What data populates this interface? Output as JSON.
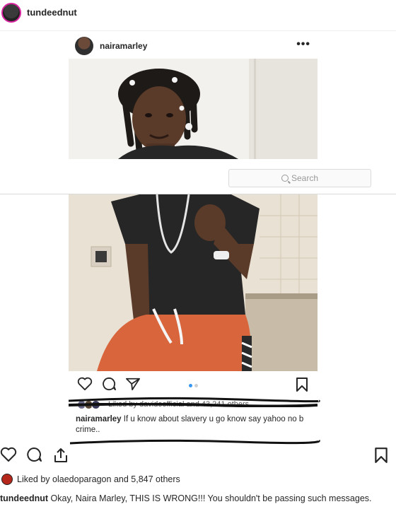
{
  "post": {
    "username": "tundeednut",
    "liked_by_prefix": "Liked by",
    "liked_by_user": "olaedoparagon",
    "liked_by_suffix": "and 5,847 others",
    "caption_username": "tundeednut",
    "caption_text": "Okay, Naira Marley, THIS IS WRONG!!! You shouldn't be passing such messages."
  },
  "embedded_post": {
    "username": "nairamarley",
    "more_icon": "•••",
    "search_placeholder": "Search",
    "likes_text": "Liked by davidoofficial and 43,241 others",
    "caption_username": "nairamarley",
    "caption_text": "If u know about slavery u go know say yahoo no b crime..",
    "carousel": {
      "count": 2,
      "active": 1
    }
  },
  "icons": [
    "heart-icon",
    "comment-icon",
    "share-icon",
    "bookmark-icon",
    "more-icon",
    "search-icon"
  ],
  "colors": {
    "accent": "#3897f0",
    "text": "#262626",
    "story_ring": "#d6249f",
    "border": "#dbdbdb"
  }
}
